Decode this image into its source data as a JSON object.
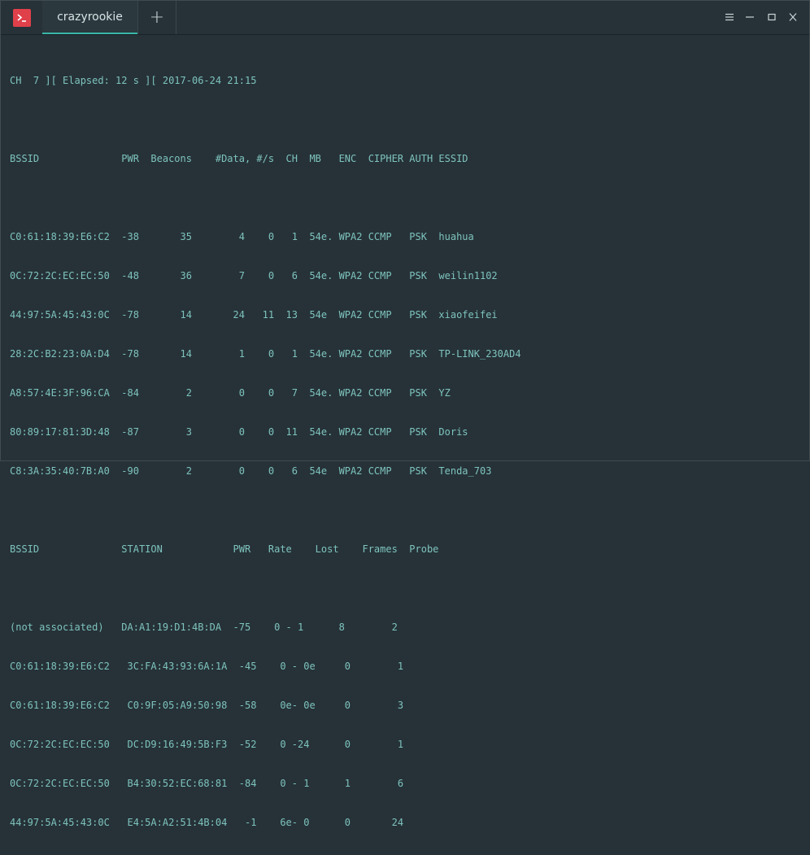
{
  "window": {
    "tab_label": "crazyrookie",
    "new_tab_symbol": "+",
    "controls": [
      "menu-icon",
      "minimize-icon",
      "maximize-icon",
      "close-icon"
    ]
  },
  "terminal": {
    "header": "CH  7 ][ Elapsed: 12 s ][ 2017-06-24 21:15",
    "ap_header": "BSSID              PWR  Beacons    #Data, #/s  CH  MB   ENC  CIPHER AUTH ESSID",
    "ap_rows": [
      "C0:61:18:39:E6:C2  -38       35        4    0   1  54e. WPA2 CCMP   PSK  huahua",
      "0C:72:2C:EC:EC:50  -48       36        7    0   6  54e. WPA2 CCMP   PSK  weilin1102",
      "44:97:5A:45:43:0C  -78       14       24   11  13  54e  WPA2 CCMP   PSK  xiaofeifei",
      "28:2C:B2:23:0A:D4  -78       14        1    0   1  54e. WPA2 CCMP   PSK  TP-LINK_230AD4",
      "A8:57:4E:3F:96:CA  -84        2        0    0   7  54e. WPA2 CCMP   PSK  YZ",
      "80:89:17:81:3D:48  -87        3        0    0  11  54e. WPA2 CCMP   PSK  Doris",
      "C8:3A:35:40:7B:A0  -90        2        0    0   6  54e  WPA2 CCMP   PSK  Tenda_703"
    ],
    "station_header": "BSSID              STATION            PWR   Rate    Lost    Frames  Probe",
    "station_rows": [
      "(not associated)   DA:A1:19:D1:4B:DA  -75    0 - 1      8        2",
      "C0:61:18:39:E6:C2   3C:FA:43:93:6A:1A  -45    0 - 0e     0        1",
      "C0:61:18:39:E6:C2   C0:9F:05:A9:50:98  -58    0e- 0e     0        3",
      "0C:72:2C:EC:EC:50   DC:D9:16:49:5B:F3  -52    0 -24      0        1",
      "0C:72:2C:EC:EC:50   B4:30:52:EC:68:81  -84    0 - 1      1        6",
      "44:97:5A:45:43:0C   E4:5A:A2:51:4B:04   -1    6e- 0      0       24"
    ]
  },
  "colors": {
    "background": "#263238",
    "text": "#7ec3bd",
    "accent": "#39b6a8",
    "app_icon": "#e0404a"
  }
}
